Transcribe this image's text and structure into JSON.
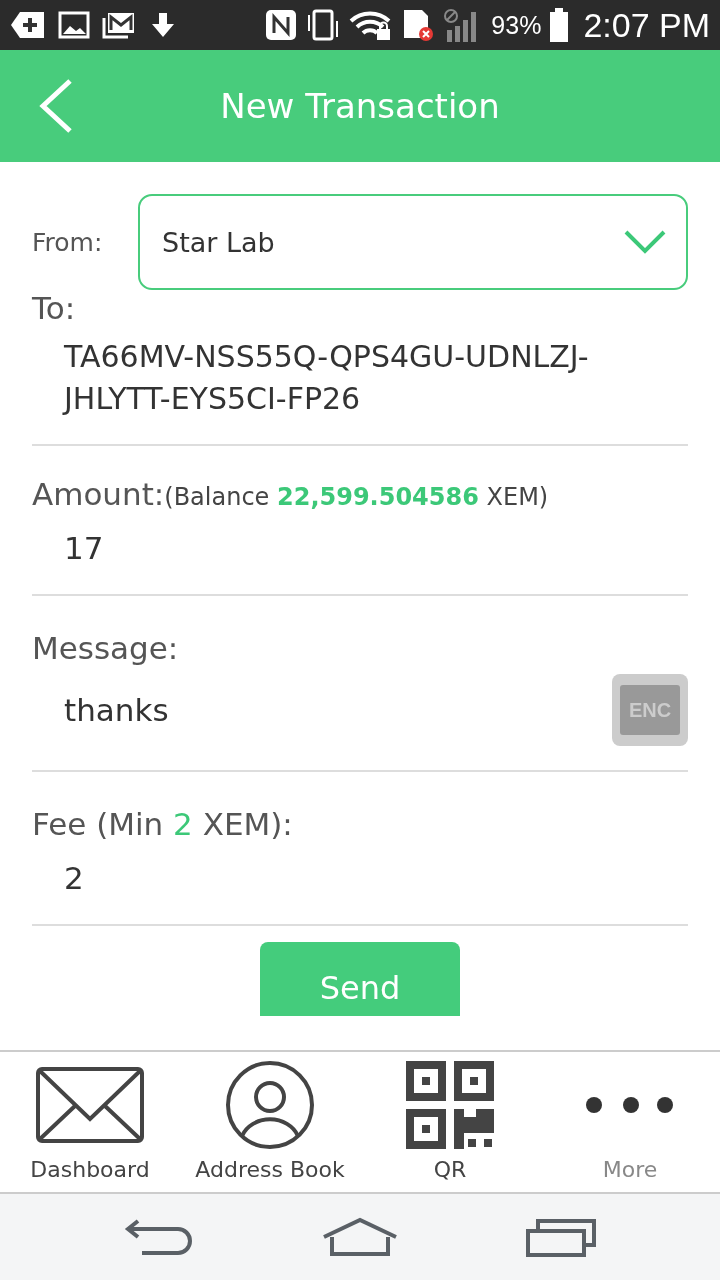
{
  "status_bar": {
    "battery": "93%",
    "time": "2:07 PM"
  },
  "header": {
    "title": "New Transaction"
  },
  "from": {
    "label": "From:",
    "value": "Star Lab"
  },
  "to": {
    "label": "To:",
    "value": "TA66MV-NSS55Q-QPS4GU-UDNLZJ-JHLYTT-EYS5CI-FP26"
  },
  "amount": {
    "label": "Amount:",
    "balance": "(Balance **22,599.504586** XEM)",
    "value": "17"
  },
  "message": {
    "label": "Message:",
    "value": "thanks",
    "enc": {
      "label": "ENC",
      "on": false
    }
  },
  "fee": {
    "label": "Fee (Min **2** XEM):",
    "value": "2"
  },
  "send_button": "Send",
  "bottom_nav": [
    {
      "kind": "envelope",
      "label": "Dashboard",
      "disabled": false
    },
    {
      "kind": "person",
      "label": "Address Book",
      "disabled": false
    },
    {
      "kind": "qr",
      "label": "QR",
      "disabled": false
    },
    {
      "kind": "dots",
      "label": "More",
      "disabled": true
    }
  ]
}
